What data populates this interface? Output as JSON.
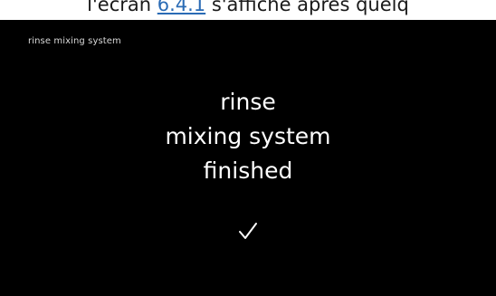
{
  "caption": {
    "prefix": "l'écran ",
    "link_text": "6.4.1",
    "suffix": " s'affiche après quelq"
  },
  "screen": {
    "title": "rinse mixing system",
    "message_lines": [
      "rinse",
      "mixing system",
      "finished"
    ],
    "done_icon": "checkmark-icon"
  },
  "colors": {
    "background": "#000000",
    "text": "#ffffff",
    "link": "#2a6bb5"
  }
}
